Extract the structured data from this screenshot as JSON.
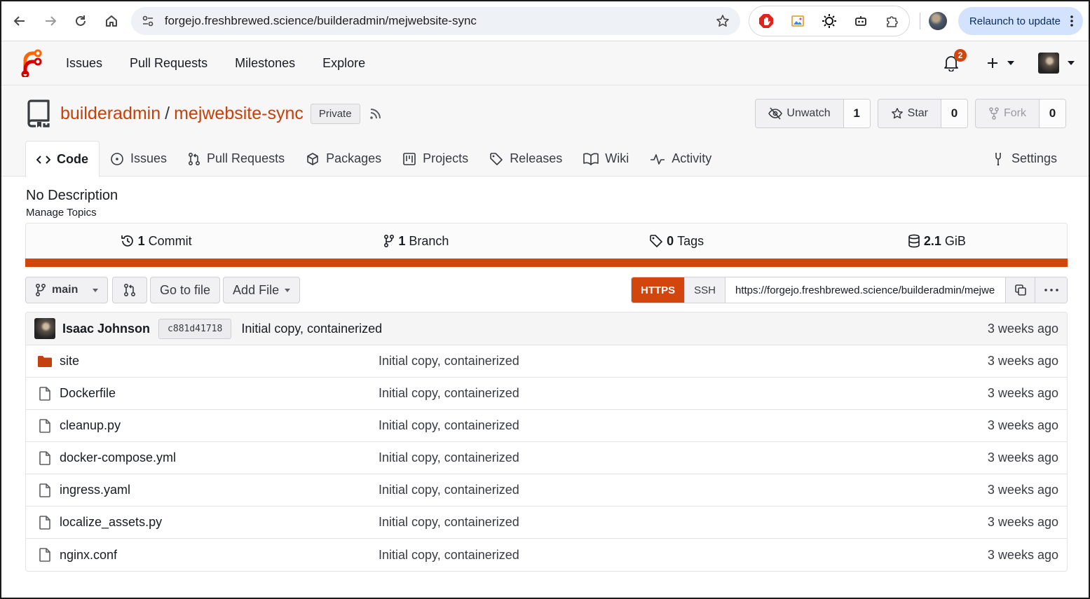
{
  "browser": {
    "url": "forgejo.freshbrewed.science/builderadmin/mejwebsite-sync",
    "relaunch_label": "Relaunch to update"
  },
  "navbar": {
    "links": [
      "Issues",
      "Pull Requests",
      "Milestones",
      "Explore"
    ],
    "notification_count": "2"
  },
  "repo": {
    "owner": "builderadmin",
    "separator": "/",
    "name": "mejwebsite-sync",
    "visibility": "Private",
    "actions": {
      "unwatch_label": "Unwatch",
      "watch_count": "1",
      "star_label": "Star",
      "star_count": "0",
      "fork_label": "Fork",
      "fork_count": "0"
    },
    "tabs": [
      "Code",
      "Issues",
      "Pull Requests",
      "Packages",
      "Projects",
      "Releases",
      "Wiki",
      "Activity"
    ],
    "settings_label": "Settings",
    "description": "No Description",
    "topics_label": "Manage Topics",
    "stats": {
      "commits_num": "1",
      "commits_label": "Commit",
      "branches_num": "1",
      "branches_label": "Branch",
      "tags_num": "0",
      "tags_label": "Tags",
      "size_num": "2.1",
      "size_unit": "GiB"
    },
    "language_color": "#d2460e"
  },
  "toolbar": {
    "branch": "main",
    "go_to_file": "Go to file",
    "add_file": "Add File",
    "clone_https": "HTTPS",
    "clone_ssh": "SSH",
    "clone_url": "https://forgejo.freshbrewed.science/builderadmin/mejwebsite-sync.git"
  },
  "latest_commit": {
    "author": "Isaac Johnson",
    "sha": "c881d41718",
    "message": "Initial copy, containerized",
    "time": "3 weeks ago"
  },
  "files": [
    {
      "name": "site",
      "type": "folder",
      "message": "Initial copy, containerized",
      "time": "3 weeks ago"
    },
    {
      "name": "Dockerfile",
      "type": "file",
      "message": "Initial copy, containerized",
      "time": "3 weeks ago"
    },
    {
      "name": "cleanup.py",
      "type": "file",
      "message": "Initial copy, containerized",
      "time": "3 weeks ago"
    },
    {
      "name": "docker-compose.yml",
      "type": "file",
      "message": "Initial copy, containerized",
      "time": "3 weeks ago"
    },
    {
      "name": "ingress.yaml",
      "type": "file",
      "message": "Initial copy, containerized",
      "time": "3 weeks ago"
    },
    {
      "name": "localize_assets.py",
      "type": "file",
      "message": "Initial copy, containerized",
      "time": "3 weeks ago"
    },
    {
      "name": "nginx.conf",
      "type": "file",
      "message": "Initial copy, containerized",
      "time": "3 weeks ago"
    }
  ],
  "colors": {
    "accent": "#d2460e",
    "link": "#c2410c"
  }
}
